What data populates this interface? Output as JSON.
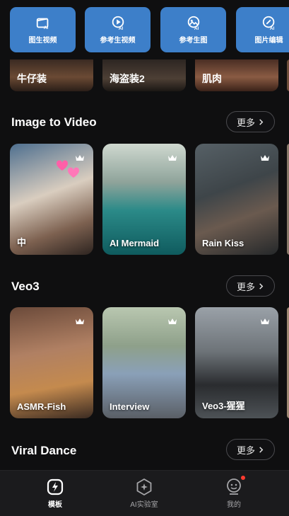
{
  "toolbar": {
    "items": [
      {
        "label": "图生视频",
        "icon": "image-to-video-icon"
      },
      {
        "label": "参考生视频",
        "icon": "reference-video-icon"
      },
      {
        "label": "参考生图",
        "icon": "reference-image-icon"
      },
      {
        "label": "图片编辑",
        "icon": "image-edit-icon"
      }
    ]
  },
  "top_strip": {
    "items": [
      {
        "label": "牛仔装"
      },
      {
        "label": "海盗装2"
      },
      {
        "label": "肌肉"
      }
    ]
  },
  "sections": [
    {
      "title": "Image to Video",
      "more_label": "更多",
      "cards": [
        {
          "label": "中",
          "premium": true
        },
        {
          "label": "AI Mermaid",
          "premium": true
        },
        {
          "label": "Rain Kiss",
          "premium": true
        }
      ]
    },
    {
      "title": "Veo3",
      "more_label": "更多",
      "cards": [
        {
          "label": "ASMR-Fish",
          "premium": true
        },
        {
          "label": "Interview",
          "premium": true
        },
        {
          "label": "Veo3-猩猩",
          "premium": true
        }
      ]
    },
    {
      "title": "Viral Dance",
      "more_label": "更多"
    }
  ],
  "tabbar": {
    "items": [
      {
        "label": "模板",
        "active": true,
        "icon": "lightning-icon"
      },
      {
        "label": "AI实验室",
        "active": false,
        "icon": "sparkle-hexagon-icon"
      },
      {
        "label": "我的",
        "active": false,
        "icon": "profile-face-icon",
        "notification_dot": true
      }
    ]
  },
  "colors": {
    "background": "#0f0f10",
    "tool_button": "#3d7fc9",
    "tabbar": "#1b1b1d",
    "active_tab": "#ffffff",
    "inactive_tab": "#a5a5a8",
    "notification": "#ff3b30"
  }
}
